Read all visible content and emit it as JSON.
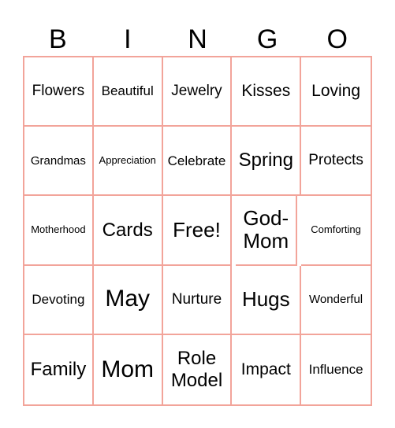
{
  "header": [
    "B",
    "I",
    "N",
    "G",
    "O"
  ],
  "cells": [
    "Flowers",
    "Beautiful",
    "Jewelry",
    "Kisses",
    "Loving",
    "Grandmas",
    "Appreciation",
    "Celebrate",
    "Spring",
    "Protects",
    "Motherhood",
    "Cards",
    "Free!",
    "God-Mom",
    "Comforting",
    "Devoting",
    "May",
    "Nurture",
    "Hugs",
    "Wonderful",
    "Family",
    "Mom",
    "Role Model",
    "Impact",
    "Influence"
  ],
  "border_color": "#f2a49a"
}
